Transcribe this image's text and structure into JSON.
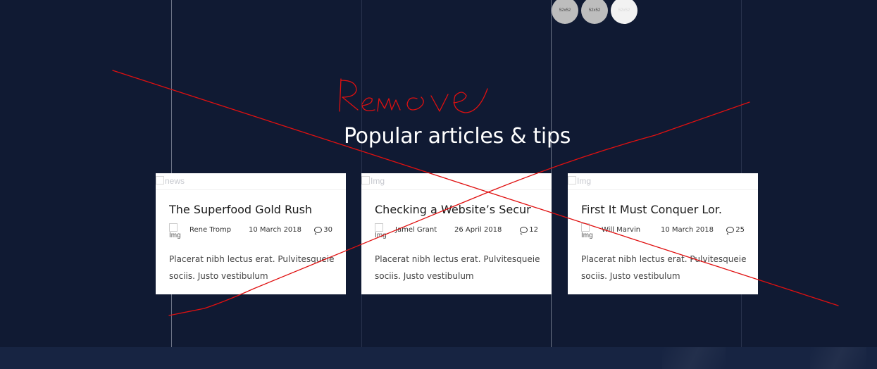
{
  "thumbnails": [
    "52x52",
    "52x52",
    "52x52"
  ],
  "section": {
    "title": "Popular articles & tips"
  },
  "articles": [
    {
      "image_alt": "news",
      "title": "The Superfood Gold Rush",
      "avatar_alt": "Img",
      "author": "Rene Tromp",
      "date": "10 March 2018",
      "comments": "30",
      "excerpt": "Placerat nibh lectus erat. Pulvitesqueie sociis. Justo vestibulum"
    },
    {
      "image_alt": "Img",
      "title": "Checking a Website’s Secur",
      "avatar_alt": "Img",
      "author": "Jamel Grant",
      "date": "26 April 2018",
      "comments": "12",
      "excerpt": "Placerat nibh lectus erat. Pulvitesqueie sociis. Justo vestibulum"
    },
    {
      "image_alt": "Img",
      "title": "First It Must Conquer Lor.",
      "avatar_alt": "Img",
      "author": "Will Marvin",
      "date": "10 March 2018",
      "comments": "25",
      "excerpt": "Placerat nibh lectus erat. Pulvitesqueie sociis. Justo vestibulum"
    }
  ],
  "annotation": {
    "text": "Remove",
    "color": "#e01010"
  },
  "colors": {
    "background": "#101a33",
    "card": "#ffffff",
    "footer": "#172442"
  }
}
